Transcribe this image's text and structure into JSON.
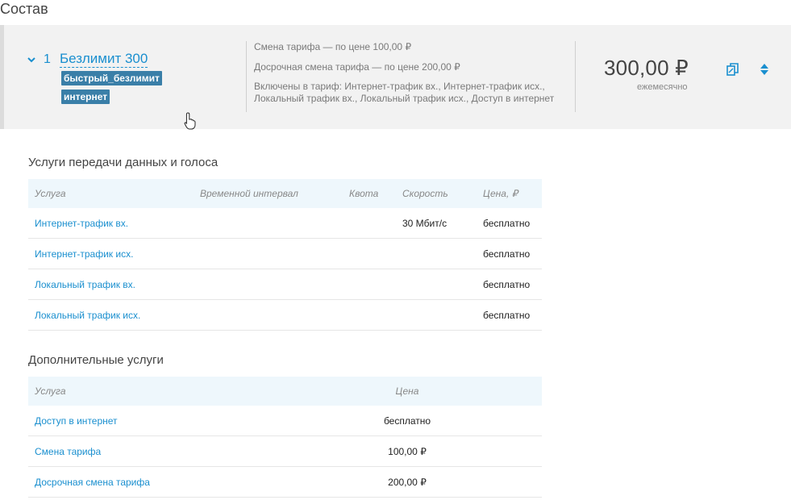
{
  "page": {
    "title": "Состав"
  },
  "tariff": {
    "number": "1",
    "name": "Безлимит 300",
    "tags": [
      "быстрый_безлимит",
      "интернет"
    ],
    "info": [
      "Смена тарифа — по цене 100,00 ₽",
      "Досрочная смена тарифа — по цене 200,00 ₽",
      "Включены в тариф: Интернет-трафик вх., Интернет-трафик исх., Локальный трафик вх., Локальный трафик исх., Доступ в интернет"
    ],
    "price": "300,00 ₽",
    "period": "ежемесячно"
  },
  "data_services": {
    "title": "Услуги передачи данных и голоса",
    "headers": [
      "Услуга",
      "Временной интервал",
      "Квота",
      "Скорость",
      "Цена, ₽"
    ],
    "rows": [
      [
        "Интернет-трафик вх.",
        "",
        "",
        "30 Мбит/с",
        "бесплатно"
      ],
      [
        "Интернет-трафик исх.",
        "",
        "",
        "",
        "бесплатно"
      ],
      [
        "Локальный трафик вх.",
        "",
        "",
        "",
        "бесплатно"
      ],
      [
        "Локальный трафик исх.",
        "",
        "",
        "",
        "бесплатно"
      ]
    ]
  },
  "extra_services": {
    "title": "Дополнительные услуги",
    "headers": [
      "Услуга",
      "Цена"
    ],
    "rows": [
      [
        "Доступ в интернет",
        "бесплатно"
      ],
      [
        "Смена тарифа",
        "100,00 ₽"
      ],
      [
        "Досрочная смена тарифа",
        "200,00 ₽"
      ]
    ]
  },
  "colors": {
    "accent": "#1a8fcf",
    "tag_bg": "#3a7fa8",
    "card_bg": "#f2f2f2",
    "table_header_bg": "#eef7fc"
  },
  "icons": [
    "chevron-down-icon",
    "hand-cursor-icon",
    "copy-icon",
    "sort-icon"
  ]
}
